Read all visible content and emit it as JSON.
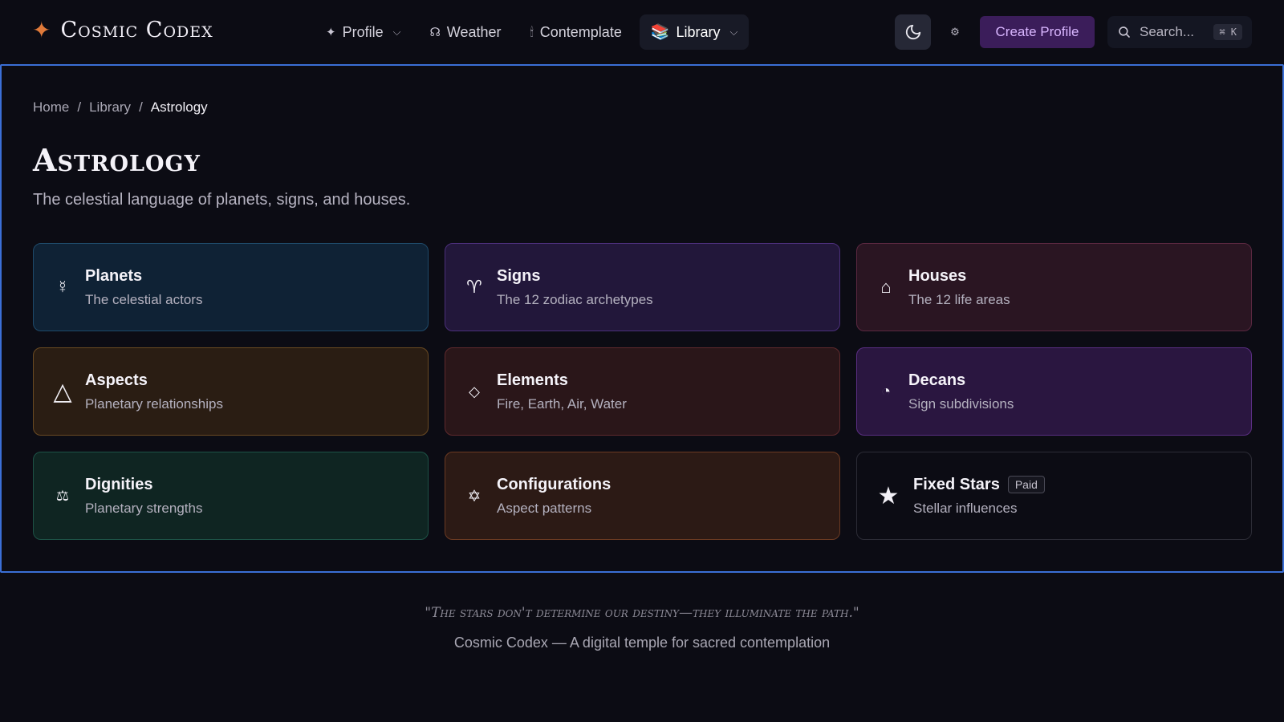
{
  "brand": {
    "icon": "sparkle-icon",
    "name": "Cosmic Codex"
  },
  "nav": {
    "profile": {
      "label": "Profile",
      "icon": "sparkle-icon"
    },
    "weather": {
      "label": "Weather",
      "icon": "omega-icon"
    },
    "contemplate": {
      "label": "Contemplate",
      "icon": "candle-icon"
    },
    "library": {
      "label": "Library",
      "icon": "books-icon"
    }
  },
  "actions": {
    "create_profile": "Create Profile",
    "search_placeholder": "Search...",
    "search_shortcut": "⌘ K"
  },
  "breadcrumb": {
    "home": "Home",
    "library": "Library",
    "current": "Astrology",
    "separator": "/"
  },
  "page": {
    "title": "Astrology",
    "subtitle": "The celestial language of planets, signs, and houses."
  },
  "cards": [
    {
      "title": "Planets",
      "desc": "The celestial actors",
      "icon": "mercury-icon",
      "glyph": "☿"
    },
    {
      "title": "Signs",
      "desc": "The 12 zodiac archetypes",
      "icon": "aries-icon",
      "glyph": "♈"
    },
    {
      "title": "Houses",
      "desc": "The 12 life areas",
      "icon": "house-icon",
      "glyph": "⌂"
    },
    {
      "title": "Aspects",
      "desc": "Planetary relationships",
      "icon": "triangle-icon",
      "glyph": "△"
    },
    {
      "title": "Elements",
      "desc": "Fire, Earth, Air, Water",
      "icon": "diamond-icon",
      "glyph": "◇"
    },
    {
      "title": "Decans",
      "desc": "Sign subdivisions",
      "icon": "pie-icon",
      "glyph": "◔"
    },
    {
      "title": "Dignities",
      "desc": "Planetary strengths",
      "icon": "scales-icon",
      "glyph": "⚖"
    },
    {
      "title": "Configurations",
      "desc": "Aspect patterns",
      "icon": "hexagram-icon",
      "glyph": "✡"
    },
    {
      "title": "Fixed Stars",
      "desc": "Stellar influences",
      "icon": "star-icon",
      "glyph": "★",
      "badge": "Paid"
    }
  ],
  "footer": {
    "quote": "\"The stars don't determine our destiny—they illuminate the path.\"",
    "tagline": "Cosmic Codex — A digital temple for sacred contemplation"
  }
}
